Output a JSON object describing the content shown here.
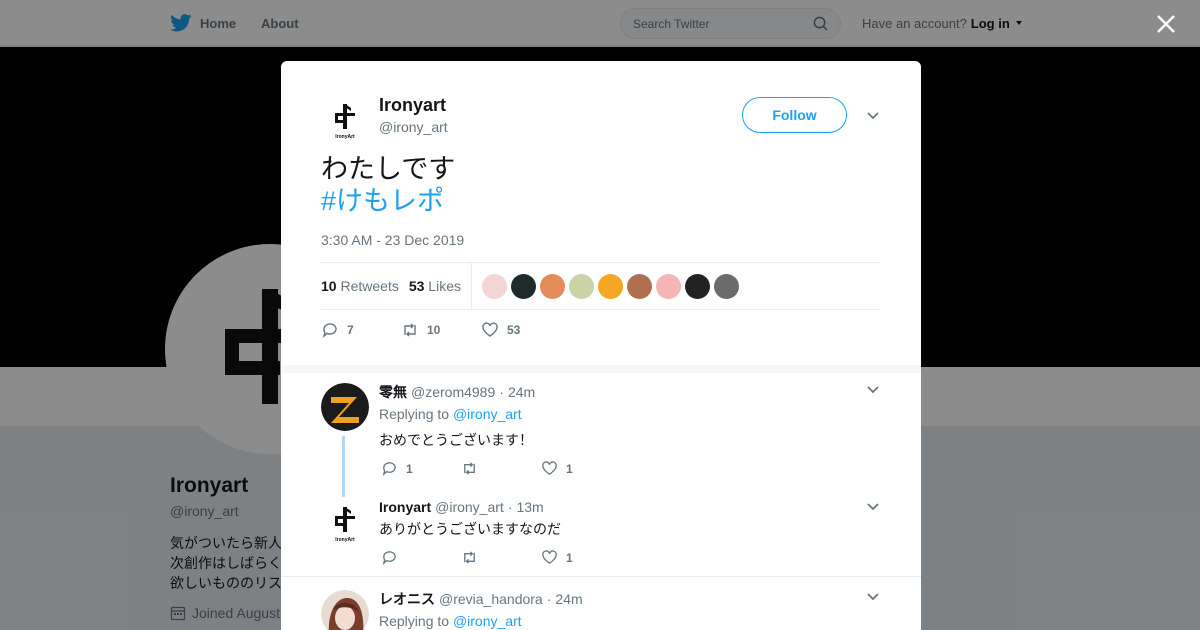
{
  "topbar": {
    "home_label": "Home",
    "about_label": "About",
    "search_placeholder": "Search Twitter",
    "account_prompt": "Have an account?",
    "login_label": "Log in"
  },
  "profile": {
    "name": "Ironyart",
    "handle": "@irony_art",
    "bio_lines": [
      "気がついたら新人",
      "次創作はしばらく",
      "欲しいもののリス"
    ],
    "joined": "Joined August",
    "avatar_text": "IronyArt"
  },
  "tweet": {
    "author_name": "Ironyart",
    "author_handle": "@irony_art",
    "follow_label": "Follow",
    "text": "わたしです",
    "hashtag": "#けもレポ",
    "timestamp": "3:30 AM - 23 Dec 2019",
    "retweets_count": "10",
    "retweets_label": "Retweets",
    "likes_count": "53",
    "likes_label": "Likes",
    "actions": {
      "replies": "7",
      "retweets": "10",
      "likes": "53"
    },
    "liker_colors": [
      "#f2d6d6",
      "#1f2a2a",
      "#e38b5a",
      "#c9d3a5",
      "#f5a623",
      "#b07050",
      "#f5b5b5",
      "#222222",
      "#6b6b6b"
    ]
  },
  "replies": [
    {
      "name": "零無",
      "handle": "@zerom4989",
      "sep": "·",
      "time": "24m",
      "replying_prefix": "Replying to",
      "replying_to": "@irony_art",
      "text": "おめでとうございます！",
      "reply_count": "1",
      "retweet_count": "",
      "like_count": "1"
    },
    {
      "name": "Ironyart",
      "handle": "@irony_art",
      "sep": "·",
      "time": "13m",
      "text": "ありがとうございますなのだ",
      "reply_count": "",
      "retweet_count": "",
      "like_count": "1"
    },
    {
      "name": "レオニス",
      "handle": "@revia_handora",
      "sep": "·",
      "time": "24m",
      "replying_prefix": "Replying to",
      "replying_to": "@irony_art"
    }
  ],
  "colors": {
    "accent": "#1da1f2",
    "text": "#14171a",
    "muted": "#66757f"
  }
}
